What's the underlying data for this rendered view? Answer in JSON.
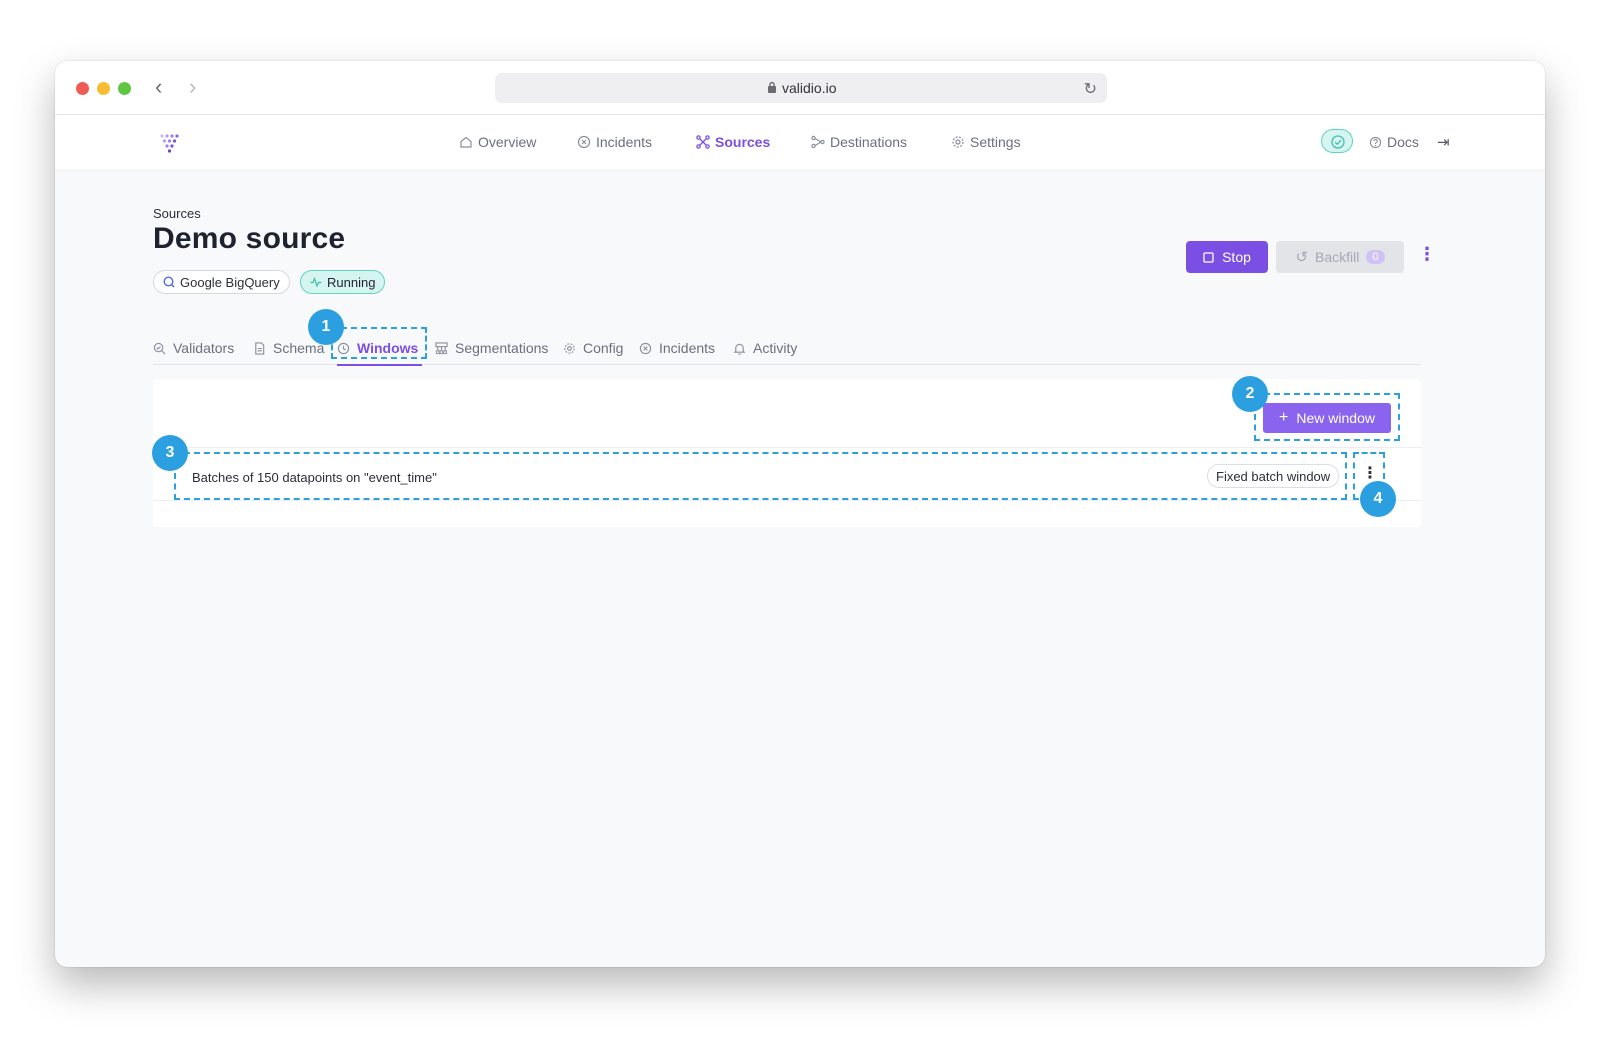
{
  "browser": {
    "url": "validio.io"
  },
  "nav": {
    "items": [
      {
        "label": "Overview",
        "icon": "home-icon"
      },
      {
        "label": "Incidents",
        "icon": "x-circle-icon"
      },
      {
        "label": "Sources",
        "icon": "sources-icon",
        "active": true
      },
      {
        "label": "Destinations",
        "icon": "destinations-icon"
      },
      {
        "label": "Settings",
        "icon": "gear-icon"
      }
    ],
    "docs_label": "Docs",
    "health_icon": "check-circle-icon",
    "logout_icon": "logout-icon"
  },
  "page": {
    "breadcrumb": "Sources",
    "title": "Demo source",
    "source_type": "Google BigQuery",
    "status": "Running",
    "stop_label": "Stop",
    "backfill_label": "Backfill",
    "backfill_count": "0"
  },
  "tabs": [
    {
      "label": "Validators",
      "icon": "validators-icon"
    },
    {
      "label": "Schema",
      "icon": "document-icon"
    },
    {
      "label": "Windows",
      "icon": "clock-icon",
      "active": true
    },
    {
      "label": "Segmentations",
      "icon": "segmentation-icon"
    },
    {
      "label": "Config",
      "icon": "gear-icon"
    },
    {
      "label": "Incidents",
      "icon": "x-circle-icon"
    },
    {
      "label": "Activity",
      "icon": "bell-icon"
    }
  ],
  "windows": {
    "new_label": "New window",
    "rows": [
      {
        "description": "Batches of 150 datapoints on \"event_time\"",
        "type": "Fixed batch window"
      }
    ]
  },
  "callouts": [
    "1",
    "2",
    "3",
    "4"
  ],
  "colors": {
    "accent": "#7b4ee4",
    "callout": "#2b9fe0",
    "running": "#5fd3c3"
  }
}
